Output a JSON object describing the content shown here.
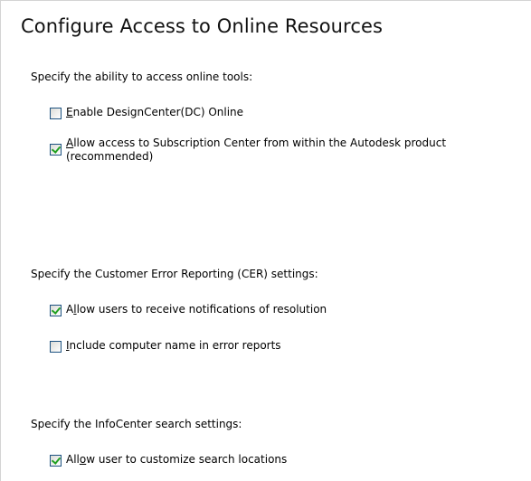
{
  "title": "Configure Access to Online Resources",
  "sections": {
    "online_tools": {
      "label": "Specify the ability to access online tools:",
      "options": [
        {
          "mnemonic": "E",
          "text_rest": "nable DesignCenter(DC) Online",
          "checked": false
        },
        {
          "mnemonic": "A",
          "text_rest": "llow access to Subscription Center from within the Autodesk product",
          "text_line2": "(recommended)",
          "checked": true
        }
      ]
    },
    "cer": {
      "label": "Specify the Customer Error Reporting (CER) settings:",
      "options": [
        {
          "text_pre": "A",
          "mnemonic": "l",
          "text_rest": "low users to receive notifications of resolution",
          "checked": true
        },
        {
          "mnemonic": "I",
          "text_rest": "nclude computer name in error reports",
          "checked": false
        }
      ]
    },
    "infocenter": {
      "label": "Specify the InfoCenter search settings:",
      "options": [
        {
          "text_pre": "All",
          "mnemonic": "o",
          "text_rest": "w user to customize search locations",
          "checked": true
        }
      ]
    }
  }
}
